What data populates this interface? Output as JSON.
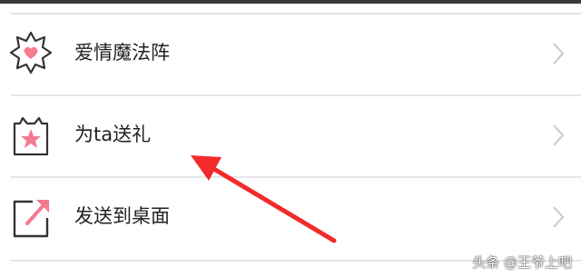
{
  "menu": {
    "items": [
      {
        "label": "爱情魔法阵",
        "icon": "star-heart-badge-icon"
      },
      {
        "label": "为ta送礼",
        "icon": "gift-star-box-icon"
      },
      {
        "label": "发送到桌面",
        "icon": "send-to-desktop-icon"
      }
    ]
  },
  "watermark": {
    "text": "头条 @王爷上吧"
  },
  "colors": {
    "accent_pink": "#f47b8f",
    "arrow_red": "#f22a2a",
    "divider": "#e6e6e6",
    "chevron": "#c8c8c8",
    "text": "#222222"
  }
}
